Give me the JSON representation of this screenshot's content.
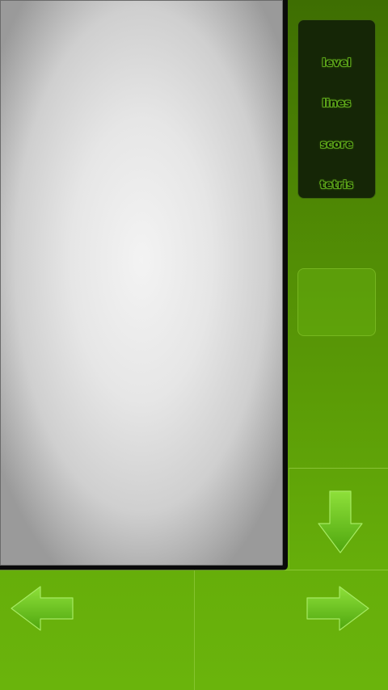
{
  "stats": {
    "level_label": "level",
    "lines_label": "lines",
    "score_label": "score",
    "tetris_label": "tetris"
  },
  "controls": {
    "down_icon": "arrow-down-icon",
    "left_icon": "arrow-left-icon",
    "right_icon": "arrow-right-icon"
  },
  "colors": {
    "background_top": "#3e6e02",
    "background_bottom": "#6ab40c",
    "stats_panel": "#152606",
    "label_glow": "#5ea81a",
    "arrow_fill": "#6ccb1c"
  }
}
